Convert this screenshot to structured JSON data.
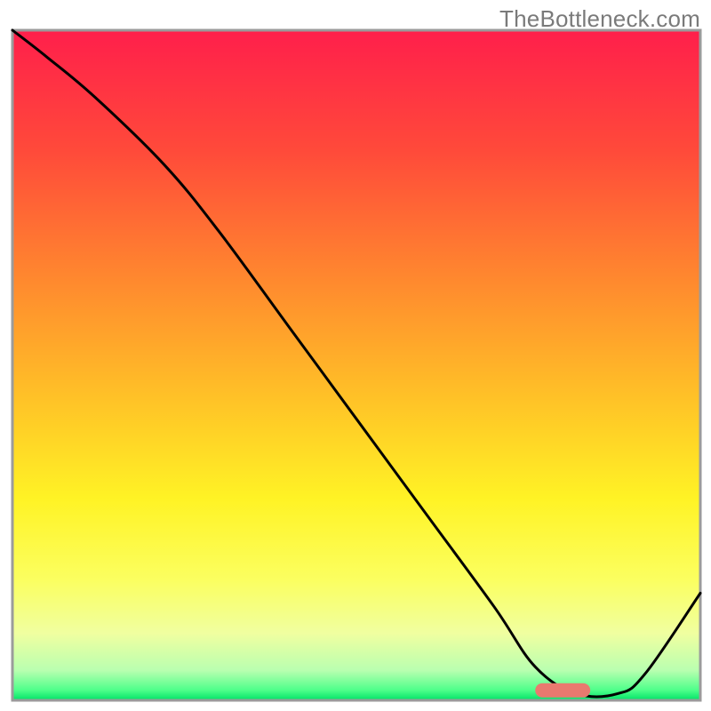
{
  "watermark": "TheBottleneck.com",
  "chart_data": {
    "type": "line",
    "title": "",
    "xlabel": "",
    "ylabel": "",
    "xlim": [
      0,
      100
    ],
    "ylim": [
      0,
      100
    ],
    "grid": false,
    "series": [
      {
        "name": "curve",
        "x": [
          0,
          5,
          12,
          22,
          30,
          40,
          50,
          60,
          70,
          76,
          82,
          88,
          92,
          100
        ],
        "values": [
          100,
          96,
          90,
          80,
          70,
          56,
          42,
          28,
          14,
          5,
          1,
          1,
          4,
          16
        ]
      }
    ],
    "marker": {
      "x_start": 76,
      "x_end": 84,
      "y": 1.5
    },
    "gradient_stops": [
      {
        "offset": 0.0,
        "color": "#ff1f4b"
      },
      {
        "offset": 0.18,
        "color": "#ff4a3a"
      },
      {
        "offset": 0.38,
        "color": "#ff8b2e"
      },
      {
        "offset": 0.55,
        "color": "#ffc227"
      },
      {
        "offset": 0.7,
        "color": "#fff325"
      },
      {
        "offset": 0.82,
        "color": "#fbff60"
      },
      {
        "offset": 0.9,
        "color": "#f0ffa0"
      },
      {
        "offset": 0.955,
        "color": "#baffb0"
      },
      {
        "offset": 0.985,
        "color": "#4dff8a"
      },
      {
        "offset": 1.0,
        "color": "#00e267"
      }
    ],
    "border_color": "#9b9b9b",
    "line_color": "#000000",
    "marker_color": "#e9796f",
    "line_width": 3
  }
}
